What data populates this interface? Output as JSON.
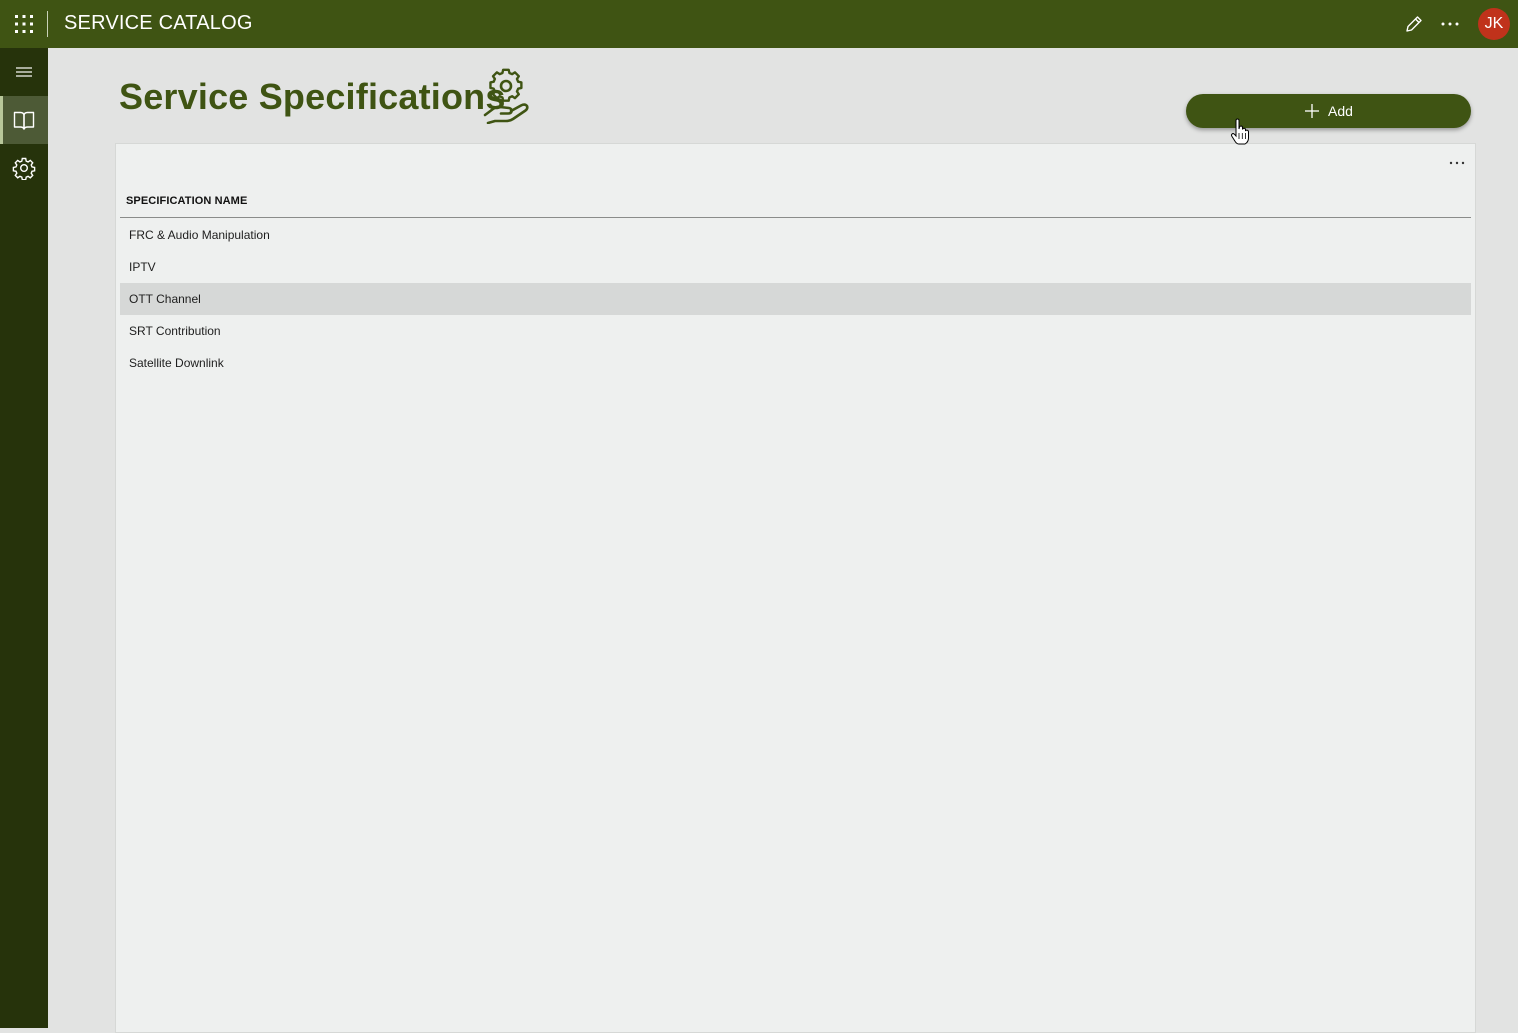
{
  "header": {
    "app_title": "SERVICE CATALOG",
    "waffle_icon": "app-launcher-icon",
    "edit_icon": "pencil-icon",
    "more_icon": "more-horizontal-icon",
    "avatar_initials": "JK",
    "avatar_color": "#c0321b",
    "brand_color": "#3f5413"
  },
  "sidebar": {
    "items": [
      {
        "icon": "hamburger-menu-icon",
        "active": false
      },
      {
        "icon": "book-icon",
        "active": true
      },
      {
        "icon": "gear-icon",
        "active": false
      }
    ]
  },
  "main": {
    "page_title": "Service Specifications",
    "title_icon": "hand-gear-icon",
    "add_button_label": "Add",
    "table": {
      "column_header": "SPECIFICATION NAME",
      "rows": [
        {
          "name": "FRC & Audio Manipulation",
          "selected": false
        },
        {
          "name": "IPTV",
          "selected": false
        },
        {
          "name": "OTT Channel",
          "selected": true
        },
        {
          "name": "SRT Contribution",
          "selected": false
        },
        {
          "name": "Satellite Downlink",
          "selected": false
        }
      ]
    }
  }
}
